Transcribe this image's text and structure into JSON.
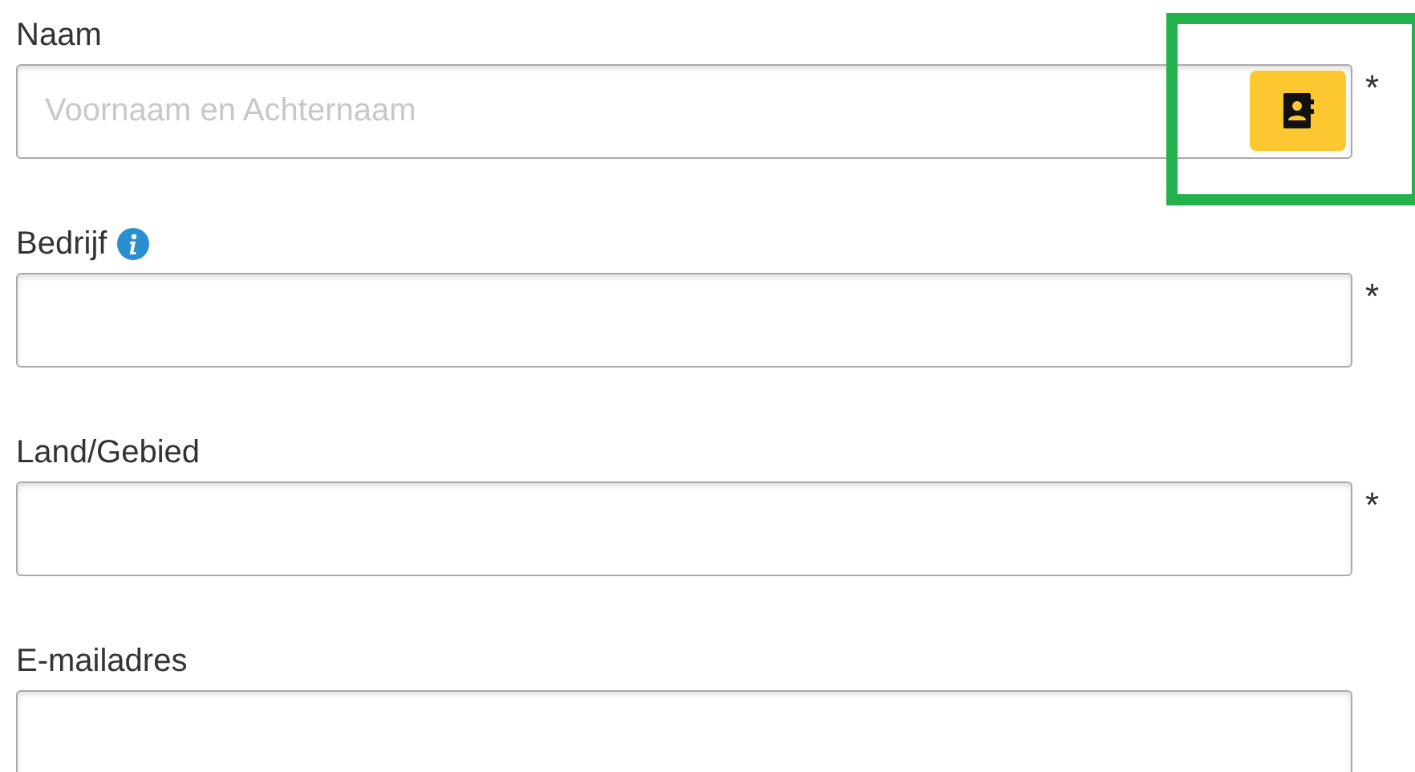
{
  "fields": [
    {
      "label": "Naam",
      "placeholder": "Voornaam en Achternaam",
      "required": true,
      "contact_button": true,
      "highlighted": true
    },
    {
      "label": "Bedrijf",
      "required": true,
      "info": true
    },
    {
      "label": "Land/Gebied",
      "required": true
    },
    {
      "label": "E-mailadres",
      "required": false
    }
  ],
  "required_mark": "*"
}
